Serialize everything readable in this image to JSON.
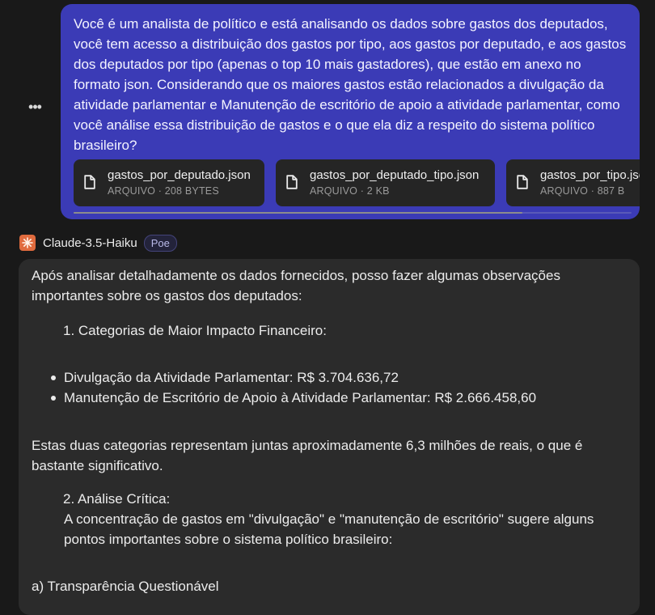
{
  "user_message": {
    "text": "Você é um analista de político e está analisando os dados sobre gastos dos deputados, você tem acesso a distribuição dos gastos por tipo, aos gastos por deputado, e aos gastos dos deputados por tipo (apenas o top 10 mais gastadores), que estão em anexo no formato json. Considerando que os maiores gastos estão relacionados a divulgação da atividade parlamentar e Manutenção de escritório de apoio a atividade parlamentar, como você análise essa distribuição de gastos e o que ela diz a respeito do sistema político brasileiro?",
    "attachments": [
      {
        "name": "gastos_por_deputado.json",
        "meta": "ARQUIVO · 208 BYTES"
      },
      {
        "name": "gastos_por_deputado_tipo.json",
        "meta": "ARQUIVO · 2 KB"
      },
      {
        "name": "gastos_por_tipo.json",
        "meta": "ARQUIVO · 887 B"
      }
    ]
  },
  "more_button": "•••",
  "bot": {
    "name": "Claude-3.5-Haiku",
    "badge": "Poe",
    "intro": "Após analisar detalhadamente os dados fornecidos, posso fazer algumas observações importantes sobre os gastos dos deputados:",
    "item1": "1. Categorias de Maior Impacto Financeiro:",
    "bullets": [
      "Divulgação da Atividade Parlamentar: R$ 3.704.636,72",
      "Manutenção de Escritório de Apoio à Atividade Parlamentar: R$ 2.666.458,60"
    ],
    "summary": "Estas duas categorias representam juntas aproximadamente 6,3 milhões de reais, o que é bastante significativo.",
    "item2_title": "2. Análise Crítica:",
    "item2_body": "A concentração de gastos em \"divulgação\" e \"manutenção de escritório\" sugere alguns pontos importantes sobre o sistema político brasileiro:",
    "subitem_a": "a) Transparência Questionável"
  },
  "colors": {
    "background": "#191919",
    "user_bubble": "#3b3bb6",
    "bot_bubble": "#2b2b2b",
    "attachment_card": "#252525",
    "bot_avatar": "#e06b3e"
  },
  "icons": [
    "more-icon",
    "file-icon",
    "claude-logo-icon"
  ]
}
